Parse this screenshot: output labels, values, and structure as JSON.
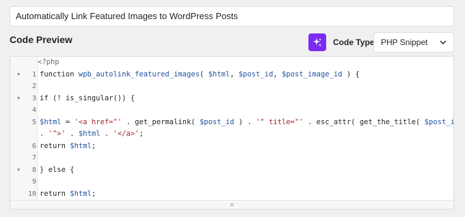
{
  "snippet_title": "Automatically Link Featured Images to WordPress Posts",
  "code_preview_label": "Code Preview",
  "code_type_label": "Code Type",
  "code_type_value": "PHP Snippet",
  "icons": {
    "magic": "sparkle-icon",
    "chevron": "chevron-down-icon",
    "resize": "drag-handle-icon"
  },
  "colors": {
    "accent": "#7b2cf2",
    "keyword": "#1d2327",
    "identifier": "#1f4f9f",
    "string": "#a0262e"
  },
  "editor": {
    "open_tag": "<?php",
    "line_numbers": [
      "1",
      "2",
      "3",
      "4",
      "5",
      "",
      "6",
      "7",
      "8",
      "9",
      "10"
    ],
    "resize_glyph": "≡"
  },
  "code": {
    "l1": {
      "kw": "function ",
      "fn": "wpb_autolink_featured_images",
      "p1": "( ",
      "v1": "$html",
      "c1": ", ",
      "v2": "$post_id",
      "c2": ", ",
      "v3": "$post_image_id",
      "p2": " ) {"
    },
    "l3": {
      "t": "if (! is_singular()) {"
    },
    "l5": {
      "v1": "$html",
      "p1": " = ",
      "s1": "'<a href=\"'",
      "p2": " . get_permalink( ",
      "v2": "$post_id",
      "p3": " ) . ",
      "s2": "'\" title=\"'",
      "p4": " . esc_attr( get_the_title( ",
      "v3": "$post_id",
      "p5": " ) )"
    },
    "l5b": {
      "p1": ". ",
      "s1": "'\">'",
      "p2": " . ",
      "v1": "$html",
      "p3": " . ",
      "s2": "'</a>'",
      "p4": ";"
    },
    "l6": {
      "kw": "return ",
      "v": "$html",
      "p": ";"
    },
    "l8": {
      "t": "} else {"
    },
    "l10": {
      "kw": "return ",
      "v": "$html",
      "p": ";"
    }
  }
}
